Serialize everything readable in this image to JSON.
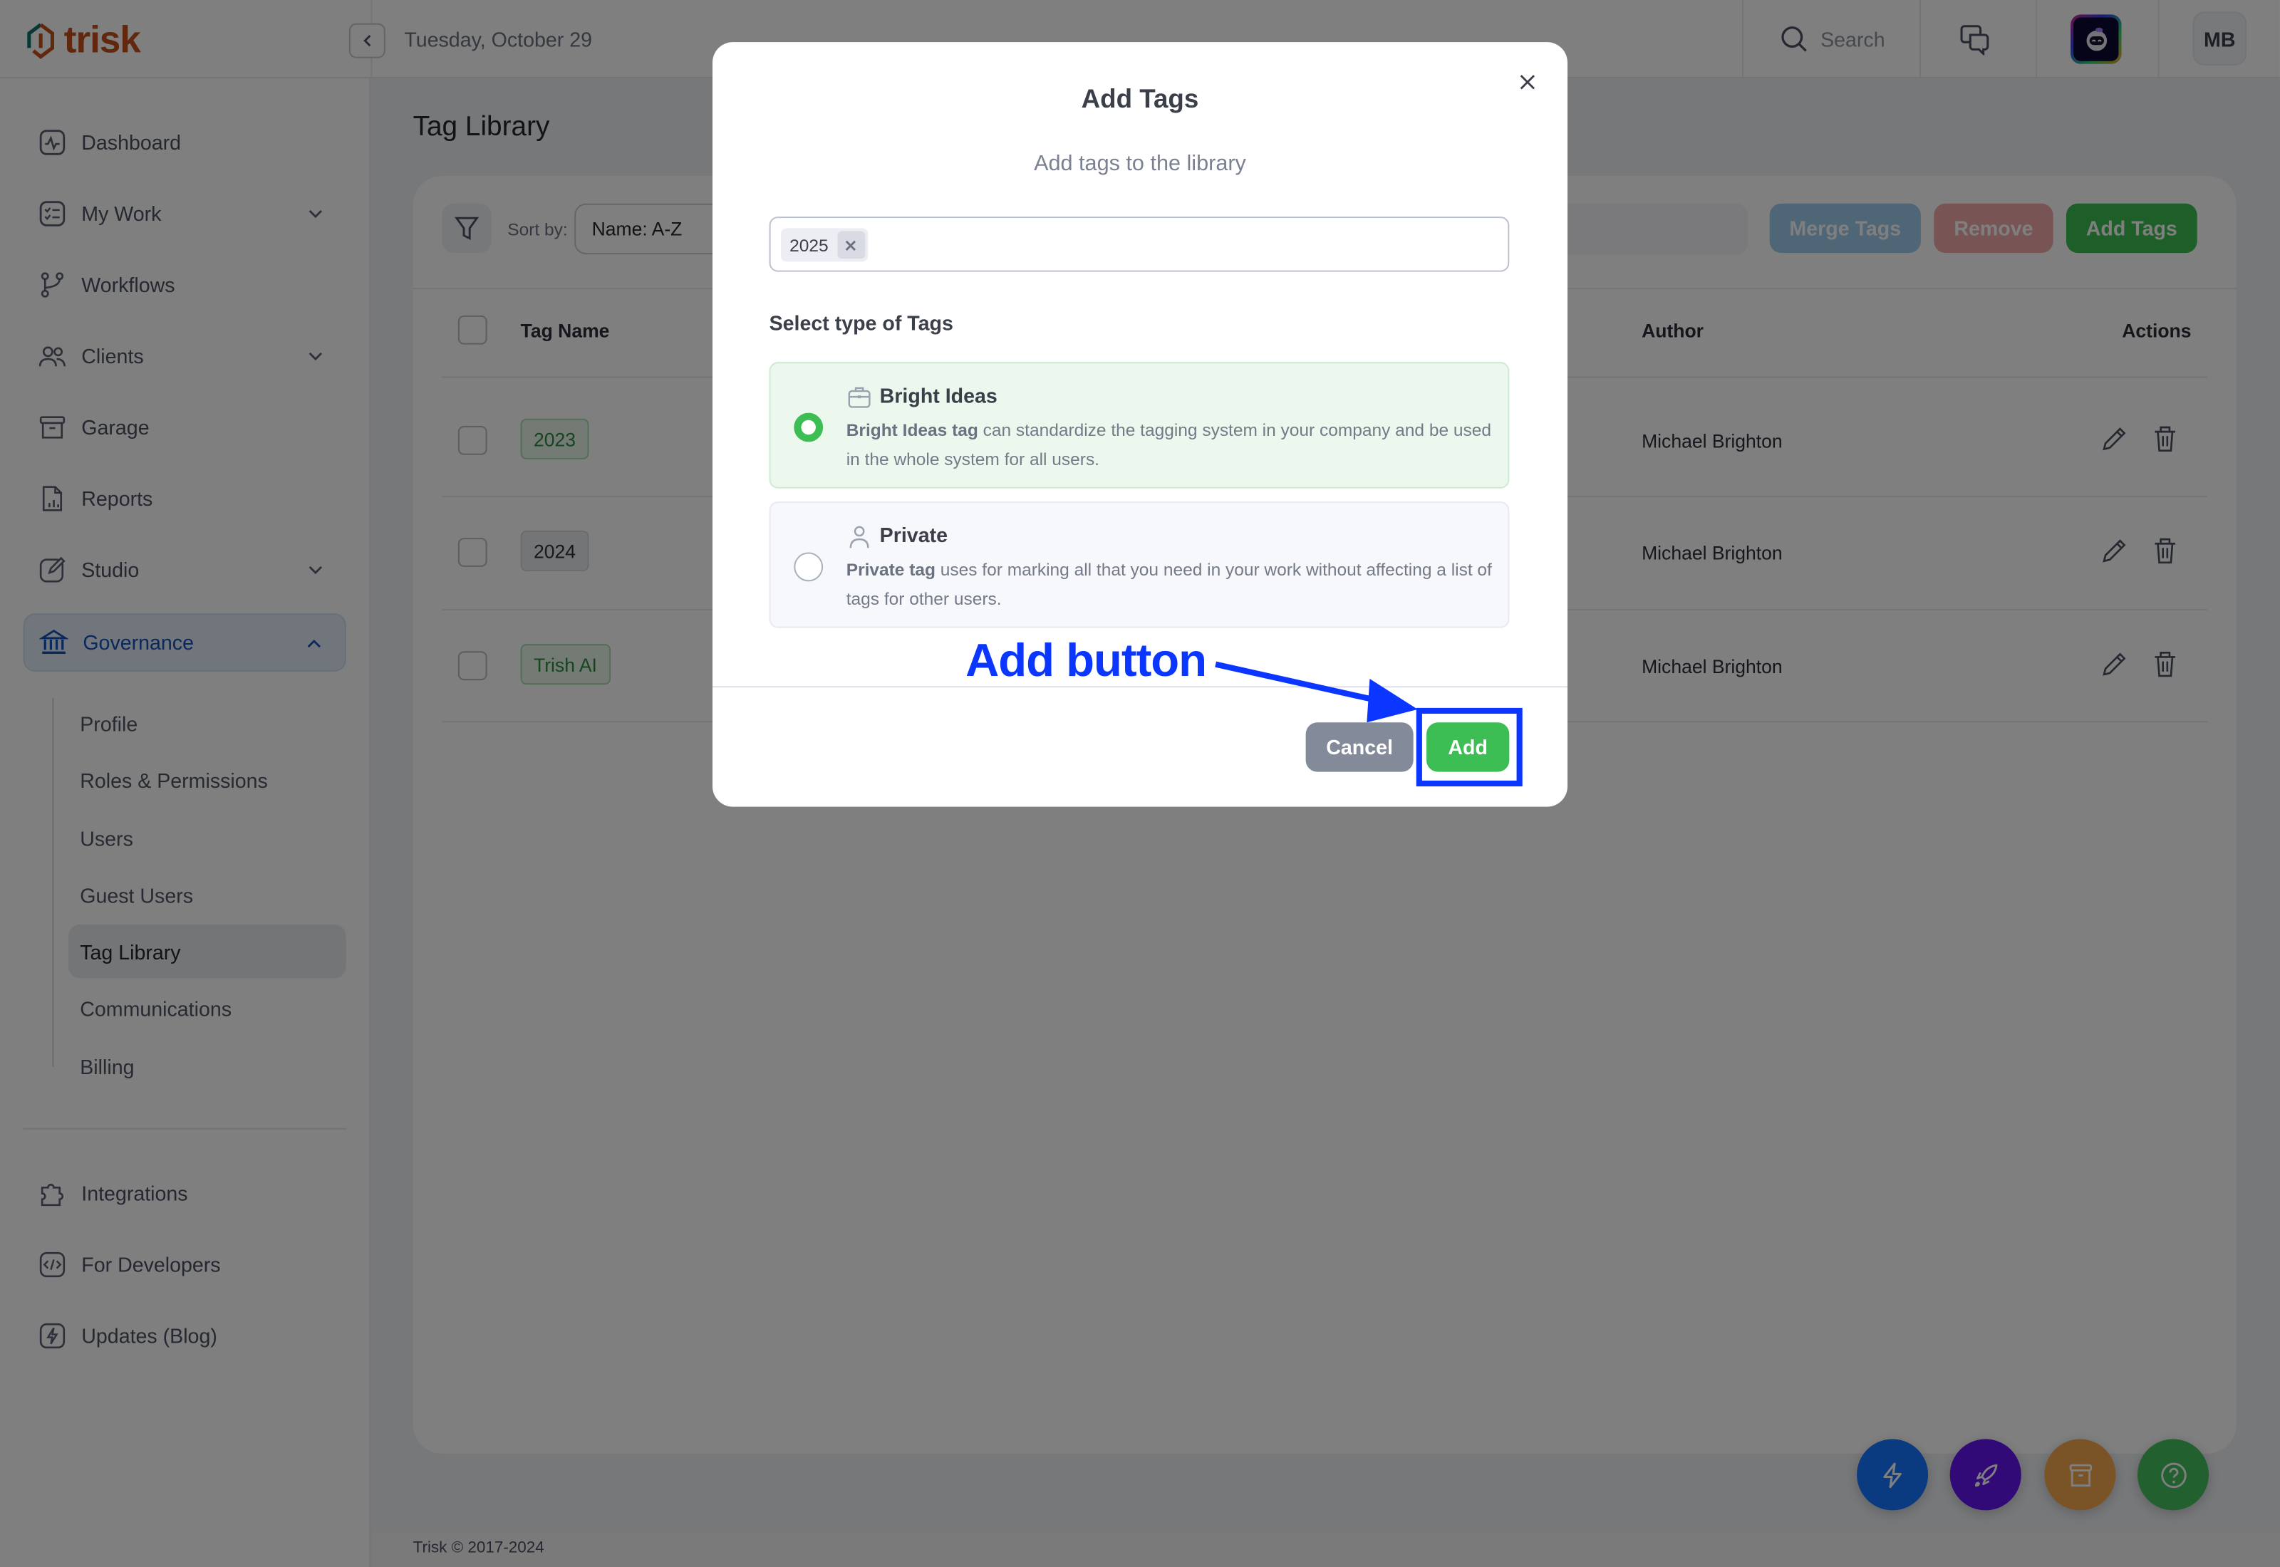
{
  "app": {
    "name": "trisk",
    "date": "Tuesday, October 29"
  },
  "header": {
    "search_label": "Search",
    "user_initials": "MB",
    "icons": [
      "search-icon",
      "chat-icon",
      "trish-ai-avatar"
    ]
  },
  "sidebar": {
    "items": [
      {
        "label": "Dashboard",
        "icon": "activity-icon"
      },
      {
        "label": "My Work",
        "icon": "checklist-icon",
        "expandable": true
      },
      {
        "label": "Workflows",
        "icon": "branch-icon"
      },
      {
        "label": "Clients",
        "icon": "users-icon",
        "expandable": true
      },
      {
        "label": "Garage",
        "icon": "archive-icon"
      },
      {
        "label": "Reports",
        "icon": "report-icon"
      },
      {
        "label": "Studio",
        "icon": "edit-square-icon",
        "expandable": true
      },
      {
        "label": "Governance",
        "icon": "bank-icon",
        "expanded": true,
        "active": true
      }
    ],
    "sub_items": [
      "Profile",
      "Roles & Permissions",
      "Users",
      "Guest Users",
      "Tag Library",
      "Communications",
      "Billing"
    ],
    "active_sub": "Tag Library",
    "bottom_items": [
      {
        "label": "Integrations",
        "icon": "puzzle-icon"
      },
      {
        "label": "For Developers",
        "icon": "code-icon"
      },
      {
        "label": "Updates (Blog)",
        "icon": "bolt-icon"
      }
    ]
  },
  "main": {
    "title": "Tag Library",
    "toolbar": {
      "sort_label": "Sort by:",
      "sort_value": "Name: A-Z",
      "merge_label": "Merge Tags",
      "remove_label": "Remove",
      "add_label": "Add Tags"
    },
    "table": {
      "columns": [
        "Tag Name",
        "Author",
        "Actions"
      ],
      "rows": [
        {
          "tag": "2023",
          "tag_style": "green",
          "author": "Michael Brighton"
        },
        {
          "tag": "2024",
          "tag_style": "gray",
          "author": "Michael Brighton"
        },
        {
          "tag": "Trish AI",
          "tag_style": "green",
          "author": "Michael Brighton"
        }
      ]
    },
    "footer": "Trisk © 2017-2024"
  },
  "fabs": [
    {
      "icon": "lightning-icon",
      "color": "#1474ff"
    },
    {
      "icon": "rocket-icon",
      "color": "#6214f0"
    },
    {
      "icon": "archive-box-icon",
      "color": "#f5a64f"
    },
    {
      "icon": "help-icon",
      "color": "#44c060"
    }
  ],
  "modal": {
    "title": "Add Tags",
    "subtitle": "Add tags to the library",
    "tags": [
      "2025"
    ],
    "section_label": "Select type of Tags",
    "options": [
      {
        "title": "Bright Ideas",
        "desc_bold": "Bright Ideas tag",
        "desc": " can standardize the tagging system in your company and be used in the whole system for all users.",
        "selected": true
      },
      {
        "title": "Private",
        "desc_bold": "Private tag",
        "desc": " uses for marking all that you need in your work without affecting a list of tags for other users.",
        "selected": false
      }
    ],
    "cancel_label": "Cancel",
    "add_label": "Add"
  },
  "annotation": {
    "label": "Add button",
    "color": "#0a36ff"
  },
  "colors": {
    "accent_green": "#3dbe55",
    "governance_blue": "#1450b8",
    "brand_orange": "#c4501c",
    "brand_teal": "#10706a"
  }
}
